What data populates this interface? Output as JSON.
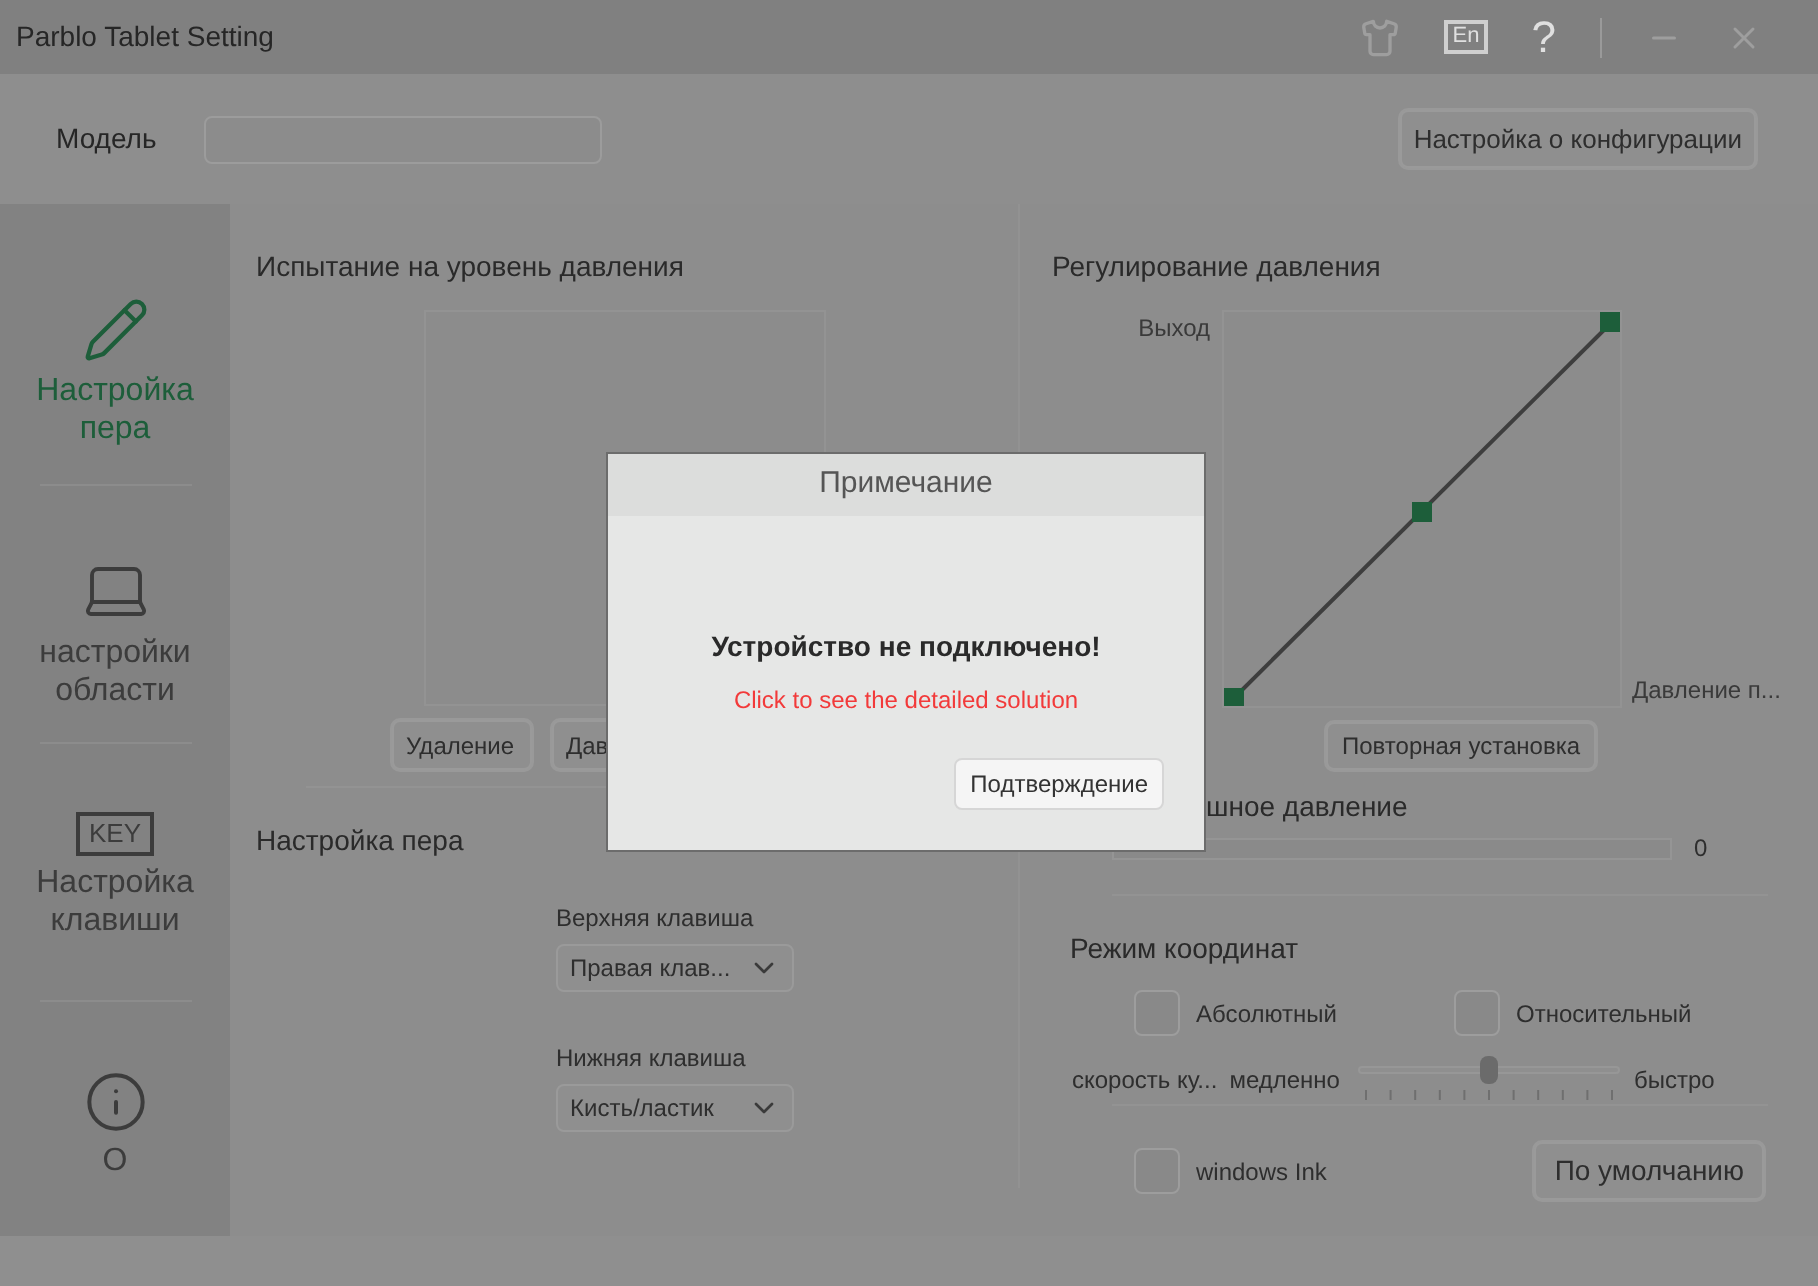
{
  "window": {
    "title": "Parblo Tablet Setting",
    "language_button": "En",
    "help_button": "?"
  },
  "model": {
    "label": "Модель",
    "config_button": "Настройка о конфигурации"
  },
  "sidebar": {
    "items": [
      {
        "kind": "pen",
        "label": "Настройка пера",
        "selected": true
      },
      {
        "kind": "area",
        "label": "настройки области",
        "selected": false
      },
      {
        "kind": "key",
        "icon_text": "KEY",
        "label": "Настройка клавиши",
        "selected": false
      },
      {
        "kind": "info",
        "label": "О",
        "selected": false
      }
    ]
  },
  "pressure_test": {
    "title": "Испытание на уровень давления",
    "buttons": [
      "Удаление",
      "Дав"
    ]
  },
  "pen_settings": {
    "title": "Настройка пера",
    "keys": [
      {
        "label": "Верхняя клавиша",
        "value": "Правая клав..."
      },
      {
        "label": "Нижняя клавиша",
        "value": "Кисть/ластик"
      }
    ]
  },
  "pressure_curve": {
    "title": "Регулирование давления",
    "y_label": "Выход",
    "x_label": "Давление п...",
    "reset_button": "Повторная установка"
  },
  "current_pressure": {
    "title": "шное давление",
    "level": 0,
    "reading": "0"
  },
  "coordinates": {
    "title": "Режим координат",
    "options": [
      {
        "label": "Абсолютный",
        "checked": false
      },
      {
        "label": "Относительный",
        "checked": false
      }
    ],
    "speed": {
      "label": "скорость ку...",
      "min_label": "медленно",
      "max_label": "быстро",
      "level": 0.5
    }
  },
  "windows_ink": {
    "label": "windows Ink",
    "checked": false
  },
  "default_button": "По умолчанию",
  "dialog": {
    "title": "Примечание",
    "message": "Устройство не подключено!",
    "link": "Click to see the detailed solution",
    "button": "Подтверждение"
  }
}
